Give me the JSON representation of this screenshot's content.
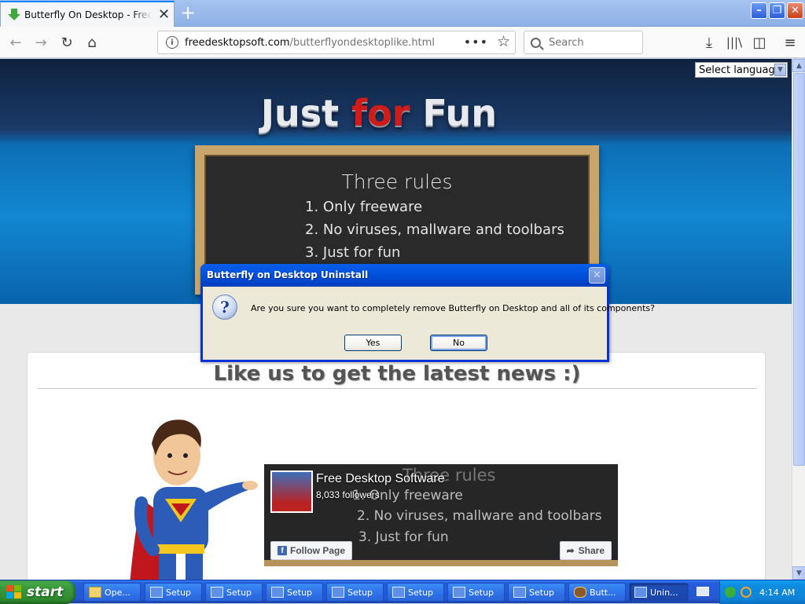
{
  "browser": {
    "tab_title": "Butterfly On Desktop - Freeware d",
    "url_host": "freedesktopsoft.com",
    "url_path": "/butterflyondesktoplike.html",
    "search_placeholder": "Search"
  },
  "page": {
    "language_select": "Select language",
    "hero_title_part1": "Just ",
    "hero_title_part2": "for",
    "hero_title_part3": " Fun",
    "board_title": "Three rules",
    "rules": [
      "1. Only freeware",
      "2. No viruses, mallware and toolbars",
      "3. Just for fun"
    ],
    "like_heading": "Like us to get the latest news :)",
    "fb": {
      "page_name": "Free Desktop Software",
      "followers": "8,033 followers",
      "follow_label": "Follow Page",
      "share_label": "Share",
      "bg_title": "Three rules",
      "bg_rules": [
        "1. Only freeware",
        "2. No viruses, mallware and toolbars",
        "3. Just for fun"
      ]
    }
  },
  "dialog": {
    "title": "Butterfly on Desktop Uninstall",
    "message": "Are you sure you want to completely remove Butterfly on Desktop and all of its components?",
    "yes_label": "Yes",
    "no_label": "No"
  },
  "taskbar": {
    "start_label": "start",
    "tasks": [
      {
        "label": "Ope...",
        "icon": "folder-icon"
      },
      {
        "label": "Setup",
        "icon": "setup-icon"
      },
      {
        "label": "Setup",
        "icon": "setup-icon"
      },
      {
        "label": "Setup",
        "icon": "setup-icon"
      },
      {
        "label": "Setup",
        "icon": "setup-icon"
      },
      {
        "label": "Setup",
        "icon": "setup-icon"
      },
      {
        "label": "Setup",
        "icon": "setup-icon"
      },
      {
        "label": "Setup",
        "icon": "setup-icon"
      },
      {
        "label": "Butt...",
        "icon": "butterfly-icon"
      },
      {
        "label": "Unin...",
        "icon": "setup-icon"
      }
    ],
    "clock": "4:14 AM"
  },
  "colors": {
    "xp_title_blue": "#0053e0",
    "hero_red": "#d01b1b",
    "facebook_blue": "#4267b2"
  }
}
